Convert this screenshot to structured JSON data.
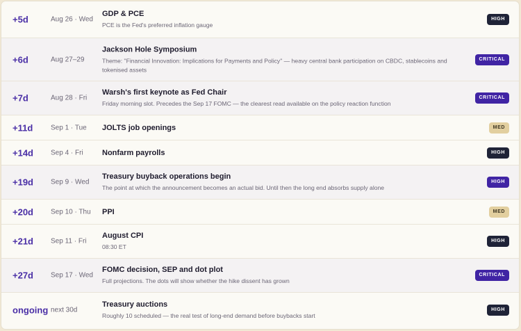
{
  "events": [
    {
      "offset": "+5d",
      "date": "Aug 26 · Wed",
      "title": "GDP & PCE",
      "desc": "PCE is the Fed's preferred inflation gauge",
      "badge": "HIGH"
    },
    {
      "offset": "+6d",
      "date": "Aug 27–29",
      "title": "Jackson Hole Symposium",
      "desc": "Theme: \"Financial Innovation: Implications for Payments and Policy\" — heavy central bank participation on CBDC, stablecoins and tokenised assets",
      "badge": "CRITICAL"
    },
    {
      "offset": "+7d",
      "date": "Aug 28 · Fri",
      "title": "Warsh's first keynote as Fed Chair",
      "desc": "Friday morning slot. Precedes the Sep 17 FOMC — the clearest read available on the policy reaction function",
      "badge": "CRITICAL"
    },
    {
      "offset": "+11d",
      "date": "Sep 1 · Tue",
      "title": "JOLTS job openings",
      "desc": "",
      "badge": "MED"
    },
    {
      "offset": "+14d",
      "date": "Sep 4 · Fri",
      "title": "Nonfarm payrolls",
      "desc": "",
      "badge": "HIGH"
    },
    {
      "offset": "+19d",
      "date": "Sep 9 · Wed",
      "title": "Treasury buyback operations begin",
      "desc": "The point at which the announcement becomes an actual bid. Until then the long end absorbs supply alone",
      "badge": "HIGH"
    },
    {
      "offset": "+20d",
      "date": "Sep 10 · Thu",
      "title": "PPI",
      "desc": "",
      "badge": "MED"
    },
    {
      "offset": "+21d",
      "date": "Sep 11 · Fri",
      "title": "August CPI",
      "desc": "08:30 ET",
      "badge": "HIGH"
    },
    {
      "offset": "+27d",
      "date": "Sep 17 · Wed",
      "title": "FOMC decision, SEP and dot plot",
      "desc": "Full projections. The dots will show whether the hike dissent has grown",
      "badge": "CRITICAL"
    },
    {
      "offset": "ongoing",
      "date": "next 30d",
      "title": "Treasury auctions",
      "desc": "Roughly 10 scheduled — the real test of long-end demand before buybacks start",
      "badge": "HIGH"
    }
  ]
}
